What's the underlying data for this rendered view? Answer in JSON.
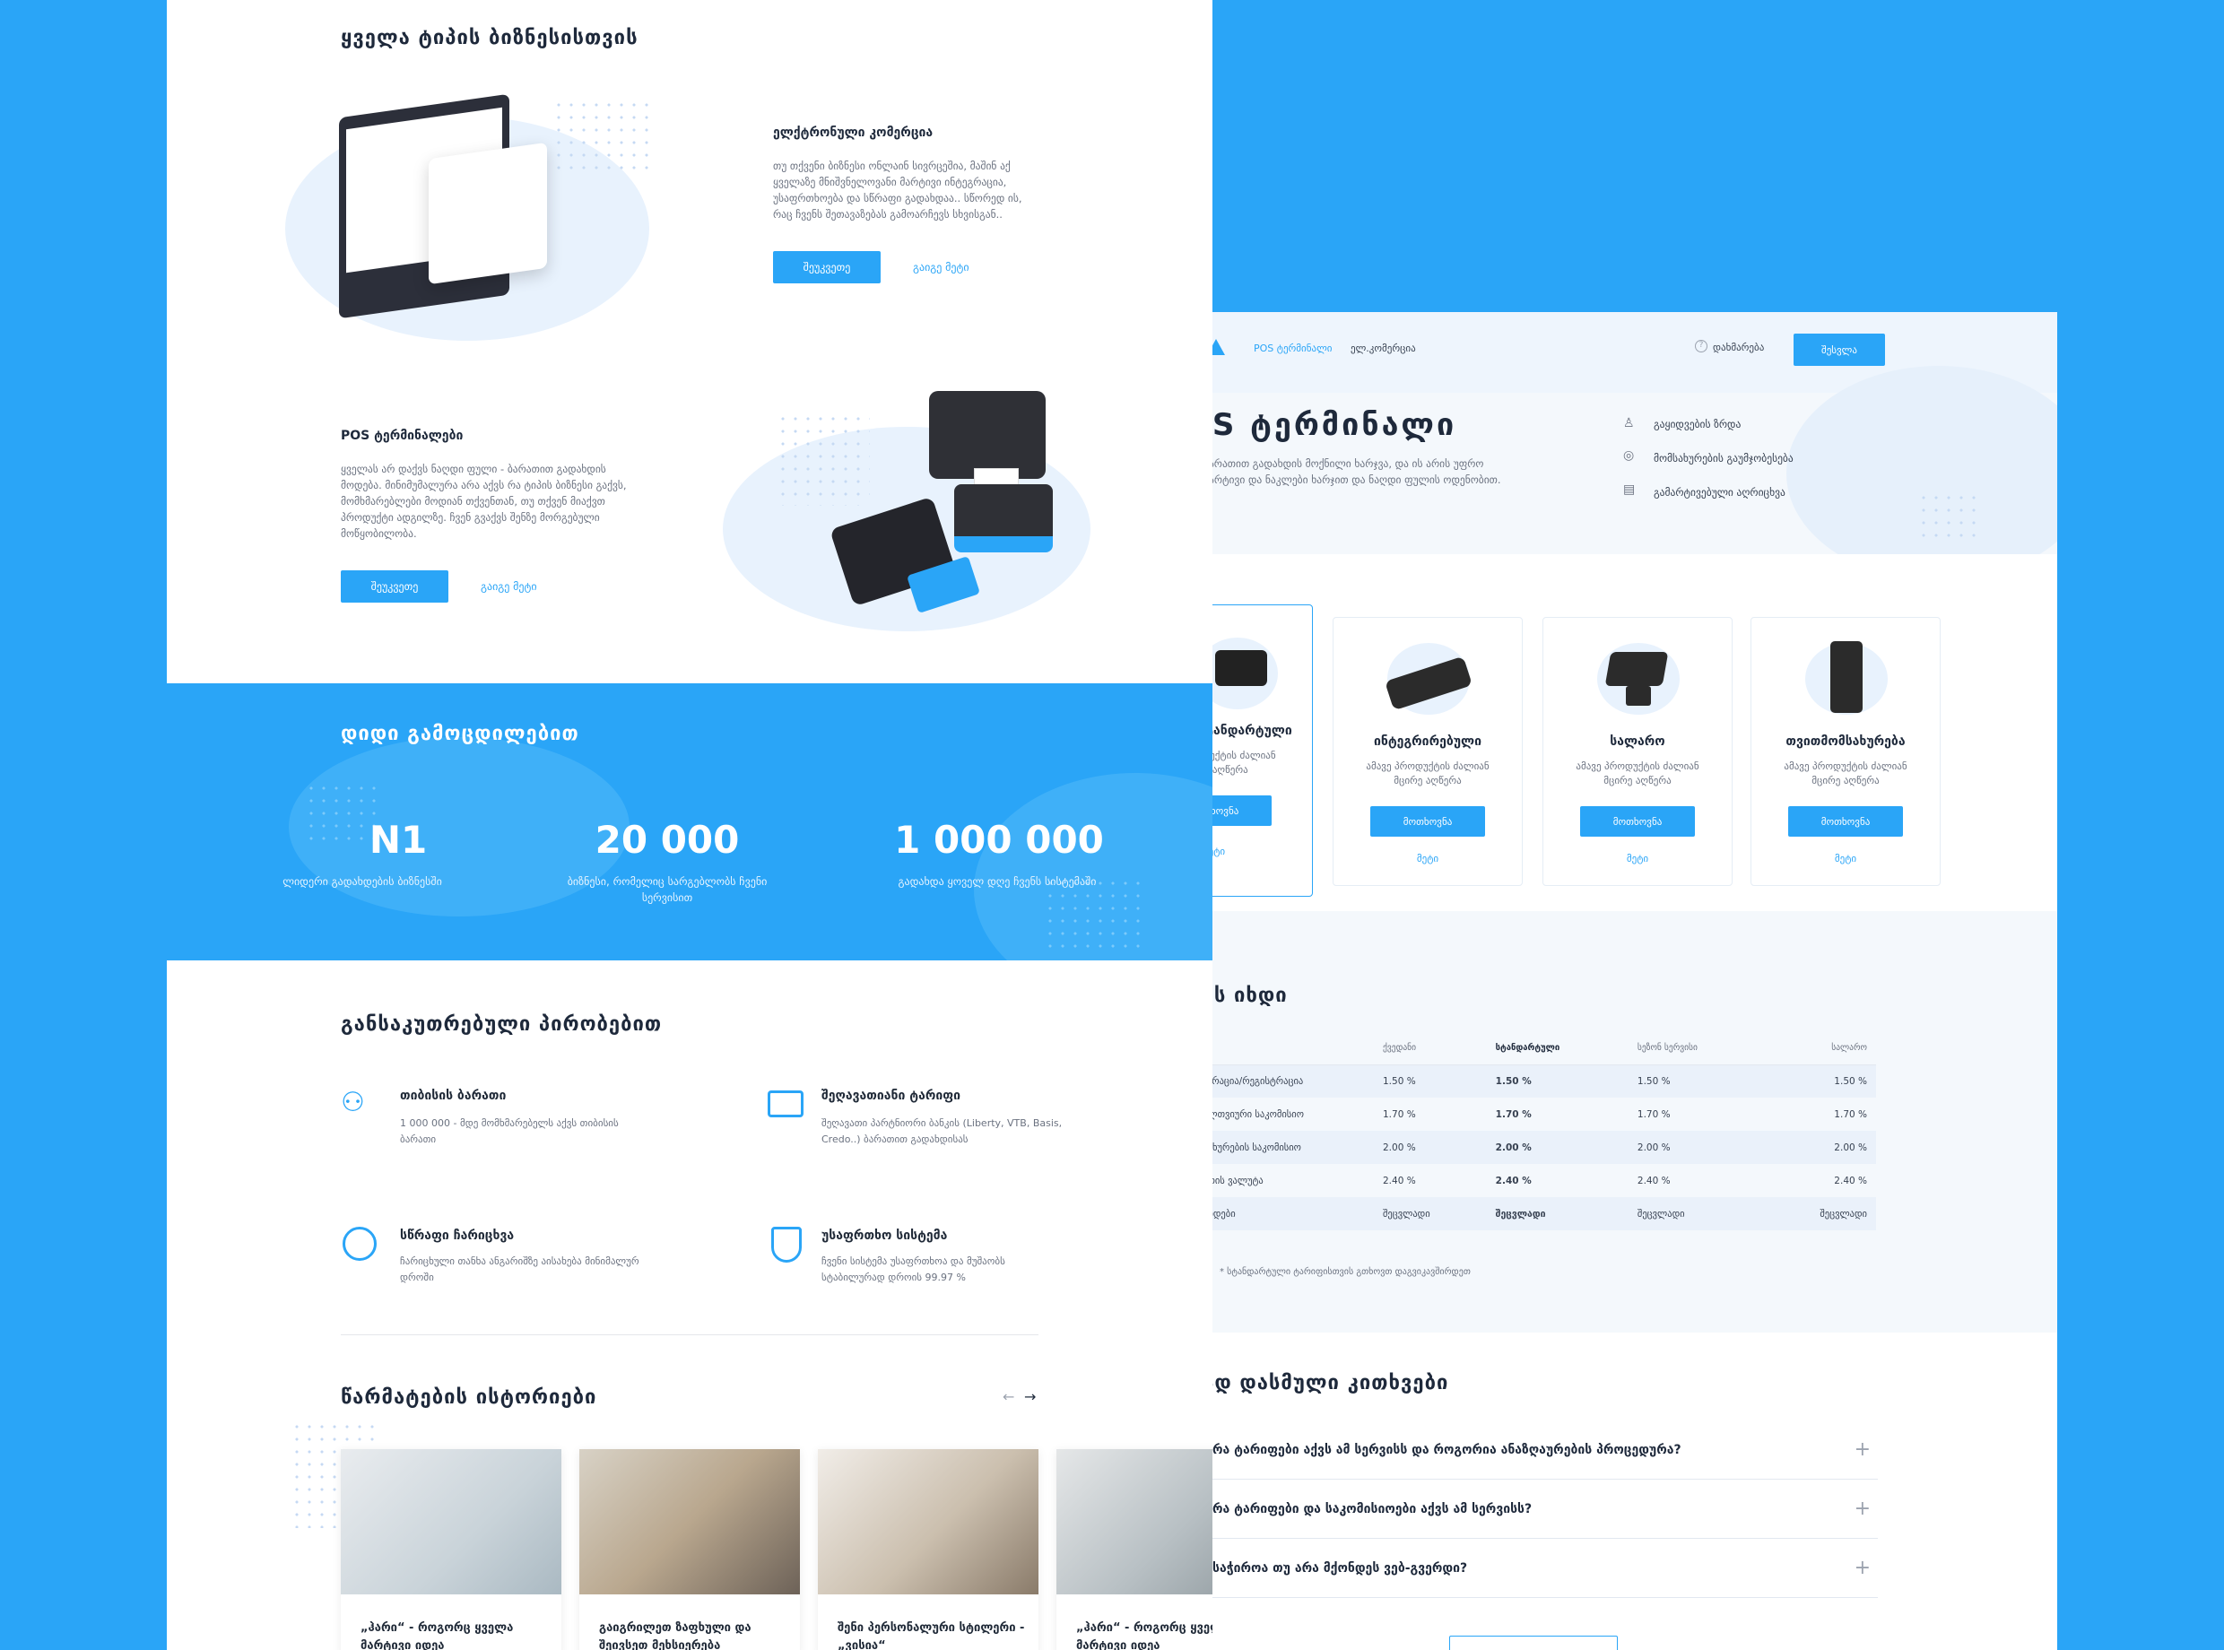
{
  "left": {
    "business_heading": "ყველა ტიპის ბიზნესისთვის",
    "ecom": {
      "title": "ელქტრონული კომერცია",
      "text": "თუ თქვენი ბიზნესი ონლაინ სივრცეშია, მაშინ აქ ყველაზე მნიშვნელოვანი მარტივი ინტეგრაცია, უსაფრთხოება და სწრაფი გადახდაა.. სწორედ ის, რაც ჩვენს შეთავაზებას გამოარჩევს სხვისგან..",
      "btn": "შეუკვეთე",
      "link": "გაიგე მეტი"
    },
    "pos": {
      "title": "POS ტერმინალები",
      "text": "ყველას არ დაქვს ნაღდი ფული - ბარათით გადახდის მოდება. მინიმუმალურა არა აქვს რა ტიპის ბიზნესი გაქვს, მომხმარებლები მოდიან თქვენთან, თუ თქვენ მიაქვთ პროდუქტი ადგილზე. ჩვენ გვაქვს შენზე მორგებული მოწყობილობა.",
      "btn": "შეუკვეთე",
      "link": "გაიგე მეტი"
    },
    "stats_heading": "დიდი გამოცდილებით",
    "stats": [
      {
        "num": "N1",
        "cap": "ლიდერი გადახდების ბიზნესში"
      },
      {
        "num": "20 000",
        "cap": "ბიზნესი, რომელიც სარგებლობს ჩვენი სერვისით"
      },
      {
        "num": "1 000 000",
        "cap": "გადახდა ყოველ დღე ჩვენს სისტემაში"
      }
    ],
    "cond_heading": "განსაკუთრებული პირობებით",
    "conds": [
      {
        "title": "თიბისის ბარათი",
        "text": "1 000 000 - მდე მომხმარებელს აქვს თიბისის ბარათი"
      },
      {
        "title": "შეღავათიანი ტარიფი",
        "text": "შეღავათი პარტნიორი ბანკის (Liberty, VTB, Basis, Credo..) ბარათით გადახდისას"
      },
      {
        "title": "სწრაფი ჩარიცხვა",
        "text": "ჩარიცხული თანხა ანგარიშზე აისახება მინიმალურ დროში"
      },
      {
        "title": "უსაფრთხო სისტემა",
        "text": "ჩვენი სისტემა უსაფრთხოა და მუშაობს სტაბილურად დროის 99.97 %"
      }
    ],
    "stories_heading": "წარმატების ისტორიები",
    "arrows": {
      "prev": "←",
      "next": "→"
    },
    "stories": [
      {
        "title": "„ჰარი“ - როგორც ყველა მარტივი იდეა"
      },
      {
        "title": "გაიგრილეთ ზაფხული და შეივსეთ მეხსიერება"
      },
      {
        "title": "შენი პერსონალური სტილერი - „ვისია“"
      },
      {
        "title": "„ჰარი“ - როგორც ყველა მარტივი იდეა"
      }
    ]
  },
  "right": {
    "nav": {
      "active": "POS ტერმინალი",
      "item2": "ელ.კომერცია",
      "help": "დახმარება",
      "login": "შესვლა"
    },
    "hero_title": "POS ტერმინალი",
    "hero_text": "ბარათით გადახდის მოქნილი ხარჯვა, და ის არის უფრო მარტივი და ნაკლები ხარჯით და ნაღდი ფულის ოდენობით.",
    "features": [
      "გაყიდვების ზრდა",
      "მომსახურების გაუმჯობესება",
      "გამარტივებული აღრიცხვა"
    ],
    "products": [
      {
        "name": "სტანდარტული",
        "desc": "ამავე პროდუქტის ძალიან მცირე აღწერა",
        "btn": "მოთხოვნა",
        "more": "მეტი"
      },
      {
        "name": "ინტეგრირებული",
        "desc": "ამავე პროდუქტის ძალიან მცირე აღწერა",
        "btn": "მოთხოვნა",
        "more": "მეტი"
      },
      {
        "name": "სალარო",
        "desc": "ამავე პროდუქტის ძალიან მცირე აღწერა",
        "btn": "მოთხოვნა",
        "more": "მეტი"
      },
      {
        "name": "თვითმომსახურება",
        "desc": "ამავე პროდუქტის ძალიან მცირე აღწერა",
        "btn": "მოთხოვნა",
        "more": "მეტი"
      }
    ],
    "tariff_heading": "რამდენს იხდი",
    "table": {
      "headers": [
        "",
        "ქვედანი",
        "სტანდარტული",
        "სეზონ სერვისი",
        "სალარო"
      ],
      "rows": [
        [
          "ინტეგრაცია/რეგისტრაცია",
          "1.50 %",
          "1.50 %",
          "1.50 %",
          "1.50 %"
        ],
        [
          "ყოველთვიური საკომისიო",
          "1.70 %",
          "1.70 %",
          "1.70 %",
          "1.70 %"
        ],
        [
          "მომსახურების საკომისიო",
          "2.00 %",
          "2.00 %",
          "2.00 %",
          "2.00 %"
        ],
        [
          "ბარათის ვალუტა",
          "2.40 %",
          "2.40 %",
          "2.40 %",
          "2.40 %"
        ],
        [
          "გადახდები",
          "შეცვლადი",
          "შეცვლადი",
          "შეცვლადი",
          "შეცვლადი"
        ]
      ],
      "note": "* სტანდარტული ტარიფისთვის გთხოვთ დაგვიკავშირდეთ"
    },
    "faq_heading": "ხშირად დასმული კითხვები",
    "faq": [
      "რა ტარიფები აქვს ამ სერვისს და როგორია ანაზღაურების პროცედურა?",
      "რა ტარიფები და საკომისიოები აქვს ამ სერვისს?",
      "საჭიროა თუ არა მქონდეს ვებ-გვერდი?"
    ],
    "plus": "+"
  }
}
